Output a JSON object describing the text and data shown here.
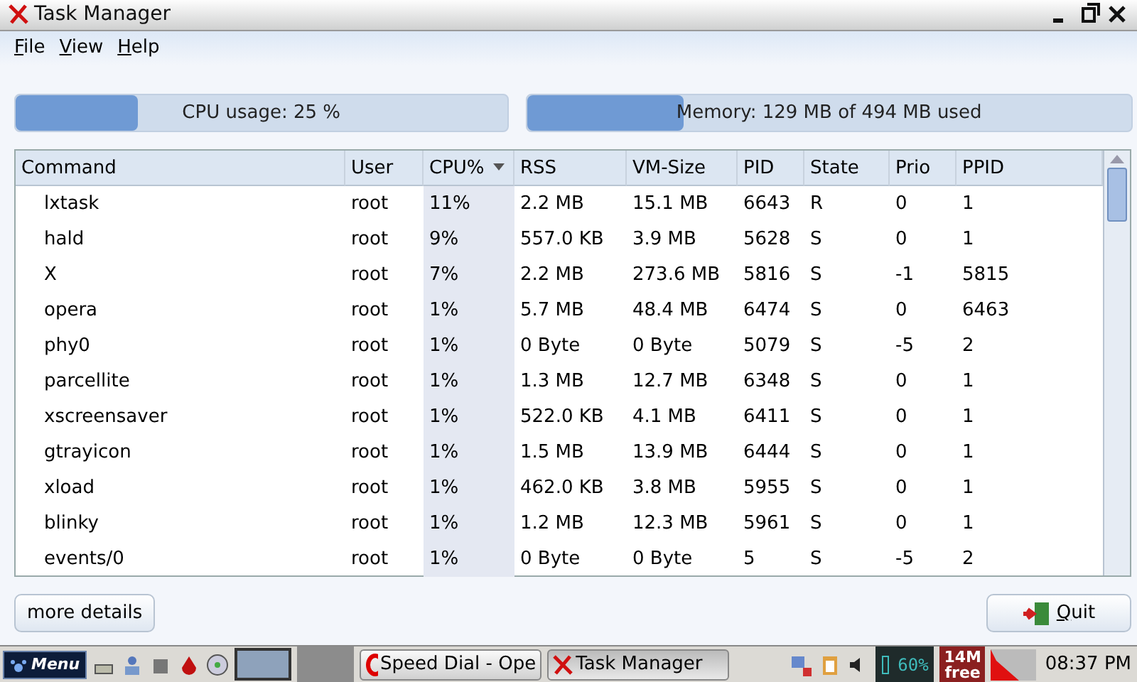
{
  "window": {
    "title": "Task Manager"
  },
  "menu": [
    "File",
    "View",
    "Help"
  ],
  "meters": [
    {
      "label": "CPU usage: 25 %",
      "level": 0.25
    },
    {
      "label": "Memory: 129 MB of 494 MB used",
      "level": 0.26
    }
  ],
  "table": {
    "columns": [
      {
        "label": "Command",
        "sorted": false
      },
      {
        "label": "User",
        "sorted": false
      },
      {
        "label": "CPU%",
        "sorted": true
      },
      {
        "label": "RSS",
        "sorted": false
      },
      {
        "label": "VM-Size",
        "sorted": false
      },
      {
        "label": "PID",
        "sorted": false
      },
      {
        "label": "State",
        "sorted": false
      },
      {
        "label": "Prio",
        "sorted": false
      },
      {
        "label": "PPID",
        "sorted": false
      }
    ],
    "rows": [
      [
        "lxtask",
        "root",
        "11%",
        "2.2 MB",
        "15.1 MB",
        "6643",
        "R",
        "0",
        "1"
      ],
      [
        "hald",
        "root",
        "9%",
        "557.0 KB",
        "3.9 MB",
        "5628",
        "S",
        "0",
        "1"
      ],
      [
        "X",
        "root",
        "7%",
        "2.2 MB",
        "273.6 MB",
        "5816",
        "S",
        "-1",
        "5815"
      ],
      [
        "opera",
        "root",
        "1%",
        "5.7 MB",
        "48.4 MB",
        "6474",
        "S",
        "0",
        "6463"
      ],
      [
        "phy0",
        "root",
        "1%",
        "0 Byte",
        "0 Byte",
        "5079",
        "S",
        "-5",
        "2"
      ],
      [
        "parcellite",
        "root",
        "1%",
        "1.3 MB",
        "12.7 MB",
        "6348",
        "S",
        "0",
        "1"
      ],
      [
        "xscreensaver",
        "root",
        "1%",
        "522.0 KB",
        "4.1 MB",
        "6411",
        "S",
        "0",
        "1"
      ],
      [
        "gtrayicon",
        "root",
        "1%",
        "1.5 MB",
        "13.9 MB",
        "6444",
        "S",
        "0",
        "1"
      ],
      [
        "xload",
        "root",
        "1%",
        "462.0 KB",
        "3.8 MB",
        "5955",
        "S",
        "0",
        "1"
      ],
      [
        "blinky",
        "root",
        "1%",
        "1.2 MB",
        "12.3 MB",
        "5961",
        "S",
        "0",
        "1"
      ],
      [
        "events/0",
        "root",
        "1%",
        "0 Byte",
        "0 Byte",
        "5",
        "S",
        "-5",
        "2"
      ]
    ]
  },
  "buttons": {
    "details": "more details",
    "quit": "Quit"
  },
  "taskbar": {
    "menu": "Menu",
    "tasks": [
      {
        "label": "Speed Dial - Ope",
        "kind": "opera",
        "selected": false
      },
      {
        "label": "Task Manager",
        "kind": "taskmanager",
        "selected": true
      }
    ],
    "battery": "60%",
    "memory": [
      "14M",
      "free"
    ],
    "clock": "08:37 PM"
  }
}
